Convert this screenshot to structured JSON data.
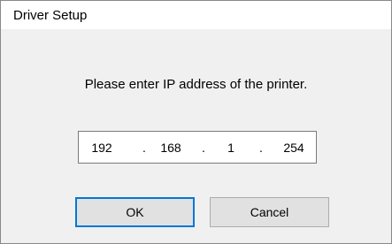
{
  "window": {
    "title": "Driver Setup"
  },
  "prompt": "Please enter IP address of the printer.",
  "ip_address": {
    "octets": [
      "192",
      "168",
      "1",
      "254"
    ],
    "separator": "."
  },
  "buttons": {
    "ok_label": "OK",
    "cancel_label": "Cancel"
  },
  "colors": {
    "focus_border": "#0078d7",
    "title_bar_bg": "#ffffff",
    "dialog_bg": "#f0f0f0",
    "button_bg": "#e1e1e1"
  }
}
